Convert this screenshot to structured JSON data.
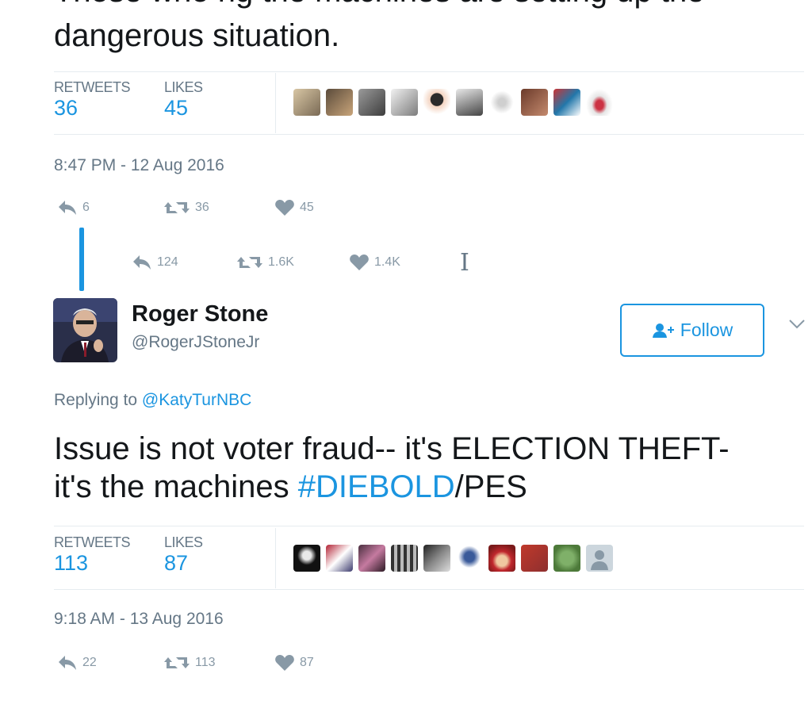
{
  "tweet1": {
    "text_clipped": "Those who rig the machines are setting up the",
    "text_visible": "dangerous situation.",
    "stats": {
      "retweets_label": "RETWEETS",
      "retweets_value": "36",
      "likes_label": "LIKES",
      "likes_value": "45"
    },
    "timestamp": "8:47 PM - 12 Aug 2016",
    "actions": {
      "replies": "6",
      "retweets": "36",
      "likes": "45"
    }
  },
  "thread_actions": {
    "replies": "124",
    "retweets": "1.6K",
    "likes": "1.4K"
  },
  "tweet2": {
    "author_name": "Roger Stone",
    "author_handle": "@RogerJStoneJr",
    "follow_label": "Follow",
    "replying_prefix": "Replying to ",
    "replying_handle": "@KatyTurNBC",
    "text_line1": "Issue is not voter fraud-- it's ELECTION THEFT-",
    "text_line2_prefix": "it's the machines ",
    "hashtag": "#DIEBOLD",
    "text_line2_suffix": "/PES",
    "stats": {
      "retweets_label": "RETWEETS",
      "retweets_value": "113",
      "likes_label": "LIKES",
      "likes_value": "87"
    },
    "timestamp": "9:18 AM - 13 Aug 2016",
    "actions": {
      "replies": "22",
      "retweets": "113",
      "likes": "87"
    }
  },
  "colors": {
    "accent": "#1b95e0",
    "muted": "#657786",
    "icon": "#8899a6",
    "divider": "#e6ecf0"
  }
}
